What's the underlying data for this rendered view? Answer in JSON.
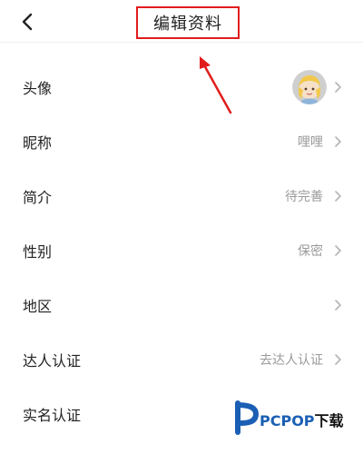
{
  "header": {
    "title": "编辑资料",
    "back_icon": "chevron-left-icon"
  },
  "rows": [
    {
      "label": "头像",
      "value": "",
      "has_avatar": true
    },
    {
      "label": "昵称",
      "value": "哩哩"
    },
    {
      "label": "简介",
      "value": "待完善"
    },
    {
      "label": "性别",
      "value": "保密"
    },
    {
      "label": "地区",
      "value": ""
    },
    {
      "label": "达人认证",
      "value": "去达人认证"
    },
    {
      "label": "实名认证",
      "value": ""
    }
  ],
  "watermark": {
    "brand": "PCPOP",
    "suffix": "下载"
  },
  "colors": {
    "annotation_red": "#e21d1d",
    "secondary_text": "#9a9a9a",
    "watermark_blue": "#1a5fb4"
  }
}
